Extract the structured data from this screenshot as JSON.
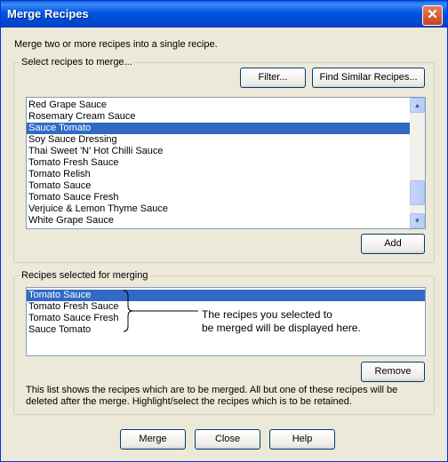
{
  "window": {
    "title": "Merge Recipes",
    "close_glyph": "✕"
  },
  "intro": "Merge two or more recipes into a single recipe.",
  "select_group": {
    "legend": "Select recipes to merge...",
    "filter_label": "Filter...",
    "find_similar_label": "Find Similar Recipes...",
    "recipes": [
      "Red Grape Sauce",
      "Rosemary Cream Sauce",
      "Sauce Tomato",
      "Soy Sauce Dressing",
      "Thai Sweet 'N' Hot Chilli Sauce",
      "Tomato Fresh Sauce",
      "Tomato Relish",
      "Tomato Sauce",
      "Tomato Sauce Fresh",
      "Verjuice & Lemon Thyme Sauce",
      "White Grape Sauce"
    ],
    "selected_recipe": "Sauce Tomato",
    "add_label": "Add"
  },
  "merge_group": {
    "legend": "Recipes selected for merging",
    "recipes": [
      "Tomato Sauce",
      "Tomato Fresh Sauce",
      "Tomato Sauce Fresh",
      "Sauce Tomato"
    ],
    "selected_recipe": "Tomato Sauce",
    "callout_line1": "The recipes you selected to",
    "callout_line2": "be merged will be displayed here.",
    "remove_label": "Remove",
    "note": "This list shows the recipes which are to be merged.  All but one of these recipes will be deleted after the merge.  Highlight/select the recipes which is to be retained."
  },
  "footer": {
    "merge_label": "Merge",
    "close_label": "Close",
    "help_label": "Help"
  },
  "icons": {
    "close": "close-icon",
    "scroll_up": "scroll-up-arrow-icon",
    "scroll_down": "scroll-down-arrow-icon"
  },
  "colors": {
    "selection": "#316ac5",
    "title_bar": "#0054e3",
    "dialog_bg": "#ece9d8"
  }
}
